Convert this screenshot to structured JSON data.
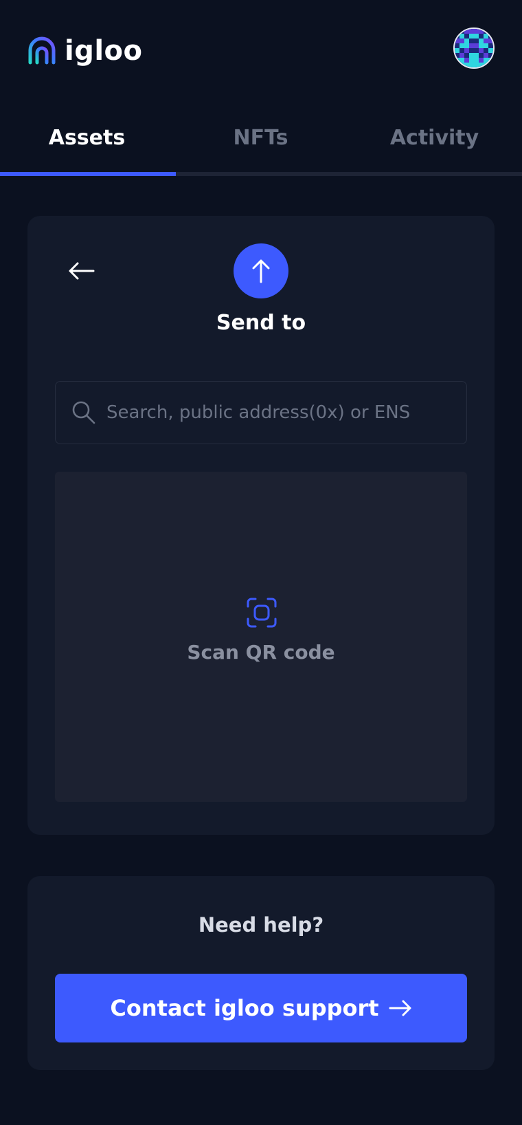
{
  "header": {
    "brand": "igloo"
  },
  "tabs": [
    {
      "label": "Assets",
      "active": true
    },
    {
      "label": "NFTs",
      "active": false
    },
    {
      "label": "Activity",
      "active": false
    }
  ],
  "send": {
    "title": "Send to",
    "search_placeholder": "Search, public address(0x) or ENS",
    "qr_label": "Scan QR code"
  },
  "help": {
    "title": "Need help?",
    "support_label": "Contact igloo support"
  },
  "icons": {
    "logo": "igloo-logo-icon",
    "avatar": "pixel-avatar",
    "back": "arrow-left-icon",
    "send": "arrow-up-icon",
    "search": "search-icon",
    "qr": "scan-qr-icon",
    "support": "arrow-right-icon"
  },
  "colors": {
    "background": "#0b1120",
    "card": "#131a2b",
    "accent": "#3d5afe",
    "muted_text": "#6b7385"
  }
}
